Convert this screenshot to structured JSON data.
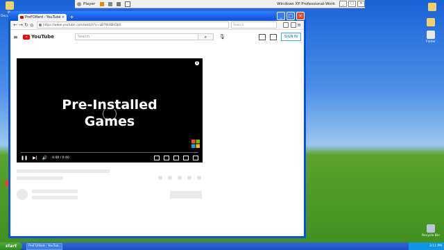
{
  "vmware": {
    "player_label": "Player",
    "vm_title": "Windows XP Professional-Work"
  },
  "desktop": {
    "icons_left": [
      "My Documents"
    ],
    "icons_right": [
      "",
      "Folder"
    ],
    "recycle_bin": "Recycle Bin"
  },
  "browser": {
    "tab_title": "PreFOlferd - YouTube",
    "url": "https://www.youtube.com/watch?v=zB7Wd8bOb0",
    "find_placeholder": "Search"
  },
  "youtube": {
    "logo": "YouTube",
    "search_placeholder": "Search",
    "signin_label": "SIGN IN",
    "video": {
      "title_line1": "Pre-Installed",
      "title_line2": "Games",
      "time": "0:00 / 0:40",
      "info_icon": "i"
    }
  },
  "taskbar": {
    "start_label": "start",
    "task_item": "PreFOlferd - YouTub...",
    "clock": "3:11 PM"
  },
  "colors": {
    "xp_blue": "#0a52d8",
    "youtube_red": "#ff0000",
    "start_green": "#3a9a2a"
  }
}
